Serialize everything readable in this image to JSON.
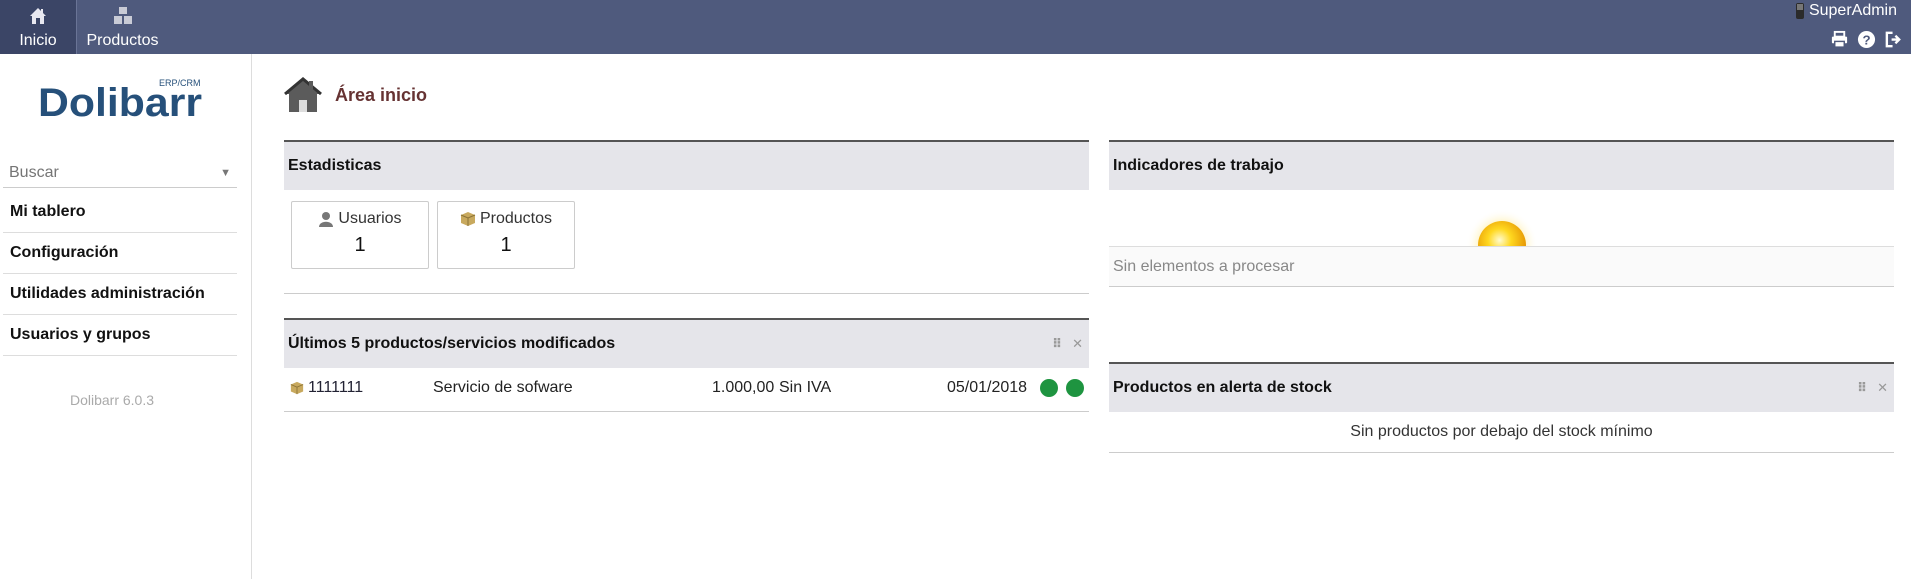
{
  "topbar": {
    "menu": [
      {
        "label": "Inicio",
        "icon": "home-icon"
      },
      {
        "label": "Productos",
        "icon": "boxes-icon"
      }
    ],
    "user": "SuperAdmin",
    "icons": [
      "print-icon",
      "help-icon",
      "logout-icon"
    ],
    "bg_color": "#4f5a7d"
  },
  "sidebar": {
    "logo_text": "Dolibarr",
    "logo_sub": "ERP/CRM",
    "search_placeholder": "Buscar",
    "items": [
      {
        "label": "Mi tablero"
      },
      {
        "label": "Configuración"
      },
      {
        "label": "Utilidades administración"
      },
      {
        "label": "Usuarios y grupos"
      }
    ],
    "version": "Dolibarr 6.0.3"
  },
  "main": {
    "title": "Área inicio",
    "stats": {
      "title": "Estadisticas",
      "cards": [
        {
          "label": "Usuarios",
          "value": "1",
          "icon": "user-icon"
        },
        {
          "label": "Productos",
          "value": "1",
          "icon": "product-icon"
        }
      ]
    },
    "last_products": {
      "title": "Últimos 5 productos/servicios modificados",
      "rows": [
        {
          "ref": "1111111",
          "description": "Servicio de sofware",
          "price": "1.000,00",
          "tax": "Sin IVA",
          "date": "05/01/2018",
          "status_color": "#1e9440"
        }
      ]
    },
    "work_indicators": {
      "title": "Indicadores de trabajo",
      "empty": "Sin elementos a procesar"
    },
    "stock_alert": {
      "title": "Productos en alerta de stock",
      "empty": "Sin productos por debajo del stock mínimo"
    }
  }
}
